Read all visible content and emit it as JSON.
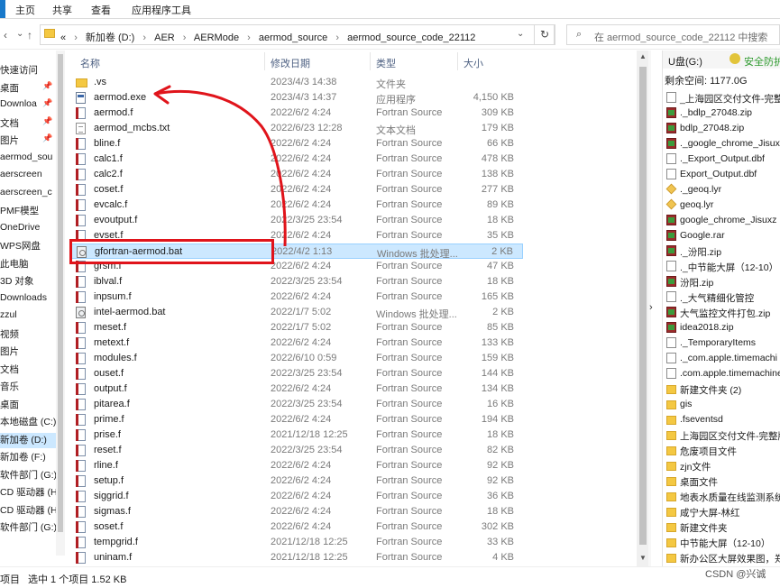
{
  "ribbon": {
    "tabs": [
      "主页",
      "共享",
      "查看",
      "应用程序工具"
    ]
  },
  "address": {
    "crumbs": [
      "新加卷 (D:)",
      "AER",
      "AERMode",
      "aermod_source",
      "aermod_source_code_22112"
    ],
    "leading": "«",
    "search_placeholder": "在 aermod_source_code_22112 中搜索"
  },
  "sidebar": {
    "items": [
      {
        "label": "快速访问",
        "pinned": false
      },
      {
        "label": "桌面",
        "pinned": true
      },
      {
        "label": "Downloa",
        "pinned": true
      },
      {
        "label": "文档",
        "pinned": true
      },
      {
        "label": "图片",
        "pinned": true
      },
      {
        "label": "aermod_sou",
        "pinned": false
      },
      {
        "label": "aerscreen",
        "pinned": false
      },
      {
        "label": "aerscreen_c",
        "pinned": false
      },
      {
        "label": "PMF模型",
        "pinned": false
      },
      {
        "label": "OneDrive",
        "pinned": false
      },
      {
        "label": "WPS网盘",
        "pinned": false
      },
      {
        "label": "此电脑",
        "pinned": false
      },
      {
        "label": "3D 对象",
        "pinned": false
      },
      {
        "label": "Downloads",
        "pinned": false
      },
      {
        "label": "zzul",
        "pinned": false
      },
      {
        "label": "视频",
        "pinned": false
      },
      {
        "label": "图片",
        "pinned": false
      },
      {
        "label": "文档",
        "pinned": false
      },
      {
        "label": "音乐",
        "pinned": false
      },
      {
        "label": "桌面",
        "pinned": false
      },
      {
        "label": "本地磁盘 (C:)",
        "pinned": false
      },
      {
        "label": "新加卷 (D:)",
        "pinned": false,
        "selected": true
      },
      {
        "label": "新加卷 (F:)",
        "pinned": false
      },
      {
        "label": "软件部门 (G:)",
        "pinned": false
      },
      {
        "label": "CD 驱动器 (H",
        "pinned": false
      },
      {
        "label": "CD 驱动器 (H:)",
        "pinned": false
      },
      {
        "label": "软件部门 (G:)",
        "pinned": false
      }
    ]
  },
  "columns": {
    "name": "名称",
    "date": "修改日期",
    "type": "类型",
    "size": "大小"
  },
  "files": [
    {
      "name": ".vs",
      "date": "2023/4/3 14:38",
      "type": "文件夹",
      "size": "",
      "icon": "folder"
    },
    {
      "name": "aermod.exe",
      "date": "2023/4/3 14:37",
      "type": "应用程序",
      "size": "4,150 KB",
      "icon": "exe"
    },
    {
      "name": "aermod.f",
      "date": "2022/6/2 4:24",
      "type": "Fortran Source",
      "size": "309 KB",
      "icon": "f"
    },
    {
      "name": "aermod_mcbs.txt",
      "date": "2022/6/23 12:28",
      "type": "文本文档",
      "size": "179 KB",
      "icon": "txt"
    },
    {
      "name": "bline.f",
      "date": "2022/6/2 4:24",
      "type": "Fortran Source",
      "size": "66 KB",
      "icon": "f"
    },
    {
      "name": "calc1.f",
      "date": "2022/6/2 4:24",
      "type": "Fortran Source",
      "size": "478 KB",
      "icon": "f"
    },
    {
      "name": "calc2.f",
      "date": "2022/6/2 4:24",
      "type": "Fortran Source",
      "size": "138 KB",
      "icon": "f"
    },
    {
      "name": "coset.f",
      "date": "2022/6/2 4:24",
      "type": "Fortran Source",
      "size": "277 KB",
      "icon": "f"
    },
    {
      "name": "evcalc.f",
      "date": "2022/6/2 4:24",
      "type": "Fortran Source",
      "size": "89 KB",
      "icon": "f"
    },
    {
      "name": "evoutput.f",
      "date": "2022/3/25 23:54",
      "type": "Fortran Source",
      "size": "18 KB",
      "icon": "f"
    },
    {
      "name": "evset.f",
      "date": "2022/6/2 4:24",
      "type": "Fortran Source",
      "size": "35 KB",
      "icon": "f"
    },
    {
      "name": "gfortran-aermod.bat",
      "date": "2022/4/2 1:13",
      "type": "Windows 批处理...",
      "size": "2 KB",
      "icon": "bat",
      "selected": true
    },
    {
      "name": "grsm.f",
      "date": "2022/6/2 4:24",
      "type": "Fortran Source",
      "size": "47 KB",
      "icon": "f"
    },
    {
      "name": "iblval.f",
      "date": "2022/3/25 23:54",
      "type": "Fortran Source",
      "size": "18 KB",
      "icon": "f"
    },
    {
      "name": "inpsum.f",
      "date": "2022/6/2 4:24",
      "type": "Fortran Source",
      "size": "165 KB",
      "icon": "f"
    },
    {
      "name": "intel-aermod.bat",
      "date": "2022/1/7 5:02",
      "type": "Windows 批处理...",
      "size": "2 KB",
      "icon": "bat"
    },
    {
      "name": "meset.f",
      "date": "2022/1/7 5:02",
      "type": "Fortran Source",
      "size": "85 KB",
      "icon": "f"
    },
    {
      "name": "metext.f",
      "date": "2022/6/2 4:24",
      "type": "Fortran Source",
      "size": "133 KB",
      "icon": "f"
    },
    {
      "name": "modules.f",
      "date": "2022/6/10 0:59",
      "type": "Fortran Source",
      "size": "159 KB",
      "icon": "f"
    },
    {
      "name": "ouset.f",
      "date": "2022/3/25 23:54",
      "type": "Fortran Source",
      "size": "144 KB",
      "icon": "f"
    },
    {
      "name": "output.f",
      "date": "2022/6/2 4:24",
      "type": "Fortran Source",
      "size": "134 KB",
      "icon": "f"
    },
    {
      "name": "pitarea.f",
      "date": "2022/3/25 23:54",
      "type": "Fortran Source",
      "size": "16 KB",
      "icon": "f"
    },
    {
      "name": "prime.f",
      "date": "2022/6/2 4:24",
      "type": "Fortran Source",
      "size": "194 KB",
      "icon": "f"
    },
    {
      "name": "prise.f",
      "date": "2021/12/18 12:25",
      "type": "Fortran Source",
      "size": "18 KB",
      "icon": "f"
    },
    {
      "name": "reset.f",
      "date": "2022/3/25 23:54",
      "type": "Fortran Source",
      "size": "82 KB",
      "icon": "f"
    },
    {
      "name": "rline.f",
      "date": "2022/6/2 4:24",
      "type": "Fortran Source",
      "size": "92 KB",
      "icon": "f"
    },
    {
      "name": "setup.f",
      "date": "2022/6/2 4:24",
      "type": "Fortran Source",
      "size": "92 KB",
      "icon": "f"
    },
    {
      "name": "siggrid.f",
      "date": "2022/6/2 4:24",
      "type": "Fortran Source",
      "size": "36 KB",
      "icon": "f"
    },
    {
      "name": "sigmas.f",
      "date": "2022/6/2 4:24",
      "type": "Fortran Source",
      "size": "18 KB",
      "icon": "f"
    },
    {
      "name": "soset.f",
      "date": "2022/6/2 4:24",
      "type": "Fortran Source",
      "size": "302 KB",
      "icon": "f"
    },
    {
      "name": "tempgrid.f",
      "date": "2021/12/18 12:25",
      "type": "Fortran Source",
      "size": "33 KB",
      "icon": "f"
    },
    {
      "name": "uninam.f",
      "date": "2021/12/18 12:25",
      "type": "Fortran Source",
      "size": "4 KB",
      "icon": "f"
    }
  ],
  "right_panel": {
    "drive": "U盘(G:)",
    "safe_label": "安全防护",
    "free_space": "剩余空间: 1177.0G",
    "items": [
      {
        "name": "_上海园区交付文件-完整版",
        "icon": "doc"
      },
      {
        "name": "._bdlp_27048.zip",
        "icon": "zip"
      },
      {
        "name": "bdlp_27048.zip",
        "icon": "zip"
      },
      {
        "name": "._google_chrome_Jisuxz",
        "icon": "zip"
      },
      {
        "name": "._Export_Output.dbf",
        "icon": "doc"
      },
      {
        "name": "Export_Output.dbf",
        "icon": "doc"
      },
      {
        "name": "._geoq.lyr",
        "icon": "lyr"
      },
      {
        "name": "geoq.lyr",
        "icon": "lyr"
      },
      {
        "name": "google_chrome_Jisuxz",
        "icon": "zip"
      },
      {
        "name": "Google.rar",
        "icon": "zip"
      },
      {
        "name": "._汾阳.zip",
        "icon": "zip"
      },
      {
        "name": "._中节能大屏（12-10）",
        "icon": "doc"
      },
      {
        "name": "汾阳.zip",
        "icon": "zip"
      },
      {
        "name": "._大气精细化管控",
        "icon": "doc"
      },
      {
        "name": "大气监控文件打包.zip",
        "icon": "zip"
      },
      {
        "name": "idea2018.zip",
        "icon": "zip"
      },
      {
        "name": "._TemporaryItems",
        "icon": "doc"
      },
      {
        "name": "._com.apple.timemachi",
        "icon": "doc"
      },
      {
        "name": ".com.apple.timemachine",
        "icon": "doc"
      },
      {
        "name": "新建文件夹 (2)",
        "icon": "fold"
      },
      {
        "name": "gis",
        "icon": "fold"
      },
      {
        "name": ".fseventsd",
        "icon": "fold"
      },
      {
        "name": "上海园区交付文件-完整版",
        "icon": "fold"
      },
      {
        "name": "危废项目文件",
        "icon": "fold"
      },
      {
        "name": "zjn文件",
        "icon": "fold"
      },
      {
        "name": "桌面文件",
        "icon": "fold"
      },
      {
        "name": "地表水质量在线监测系统",
        "icon": "fold"
      },
      {
        "name": "咸宁大屏-林红",
        "icon": "fold"
      },
      {
        "name": "新建文件夹",
        "icon": "fold"
      },
      {
        "name": "中节能大屏（12-10）",
        "icon": "fold"
      },
      {
        "name": "新办公区大屏效果图，郑",
        "icon": "fold"
      }
    ]
  },
  "status": {
    "count": "项目",
    "selected": "选中 1 个项目  1.52 KB"
  },
  "watermark": "CSDN @兴诚",
  "colors": {
    "annotation": "#e0141b",
    "selection": "#cce8ff",
    "accent": "#1979ca"
  }
}
